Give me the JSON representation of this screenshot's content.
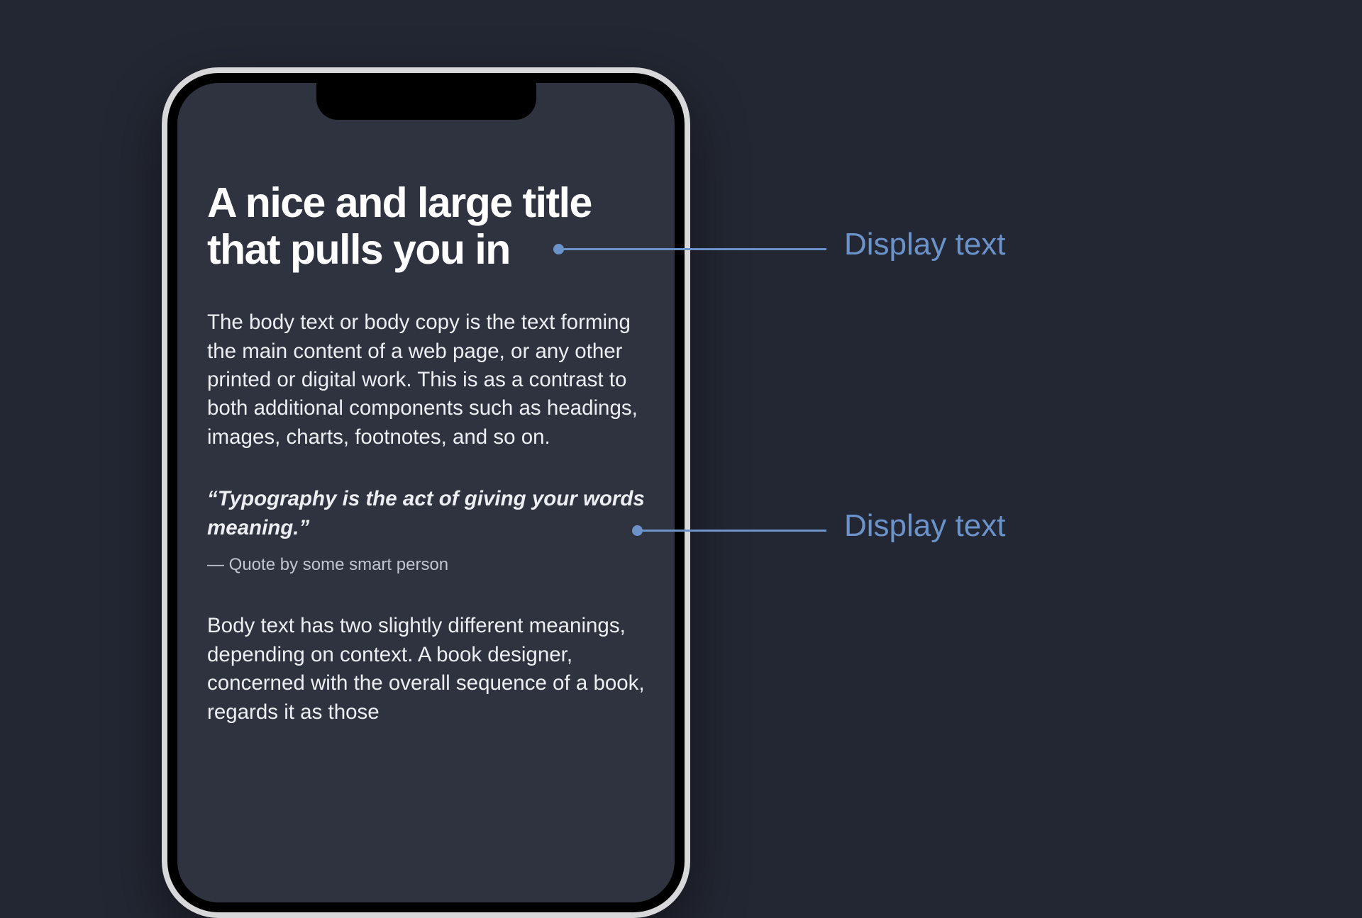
{
  "phone": {
    "title": "A nice and large title that pulls you in",
    "body1": "The body text or body copy is the text forming the main content of a web page, or any other printed or digital work. This is as a contrast to both additional components such as headings, images, charts, footnotes, and so on.",
    "quote": "“Typography is the act of giving your words meaning.”",
    "quoteAuthor": "— Quote by some smart person",
    "body2": "Body text has two slightly different meanings, depending on context. A book designer, concerned with the overall sequence of a book, regards it as those"
  },
  "annotations": {
    "label1": "Display text",
    "label2": "Display text"
  },
  "colors": {
    "background": "#232733",
    "phoneScreen": "#2e333f",
    "accent": "#6b93c9",
    "textPrimary": "#ffffff",
    "textBody": "#eceef2"
  }
}
